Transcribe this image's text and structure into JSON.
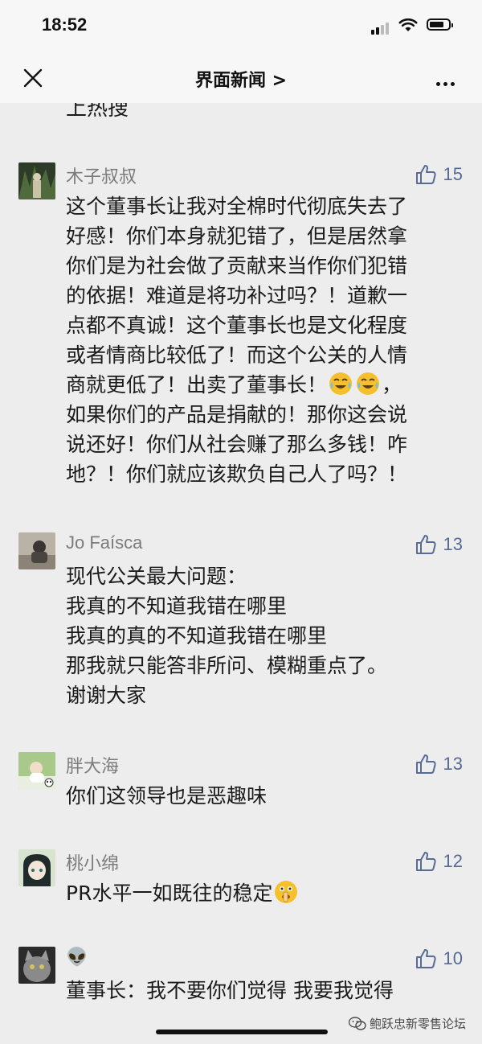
{
  "status_bar": {
    "time": "18:52"
  },
  "nav": {
    "title": "界面新闻 >"
  },
  "truncated_text": "上热搜",
  "comments": [
    {
      "user": "木子叔叔",
      "likes": "15",
      "text_a": "这个董事长让我对全棉时代彻底失去了\n好感！你们本身就犯错了，但是居然拿\n你们是为社会做了贡献来当作你们犯错\n的依据！难道是将功补过吗？！道歉一\n点都不真诚！这个董事长也是文化程度\n或者情商比较低了！而这个公关的人情\n商就更低了！出卖了董事长！",
      "text_b": "，\n如果你们的产品是捐献的！那你这会说\n说还好！你们从社会赚了那么多钱！咋\n地？！你们就应该欺负自己人了吗？！",
      "emojis": [
        "crying-laughing-emoji",
        "crying-laughing-emoji"
      ]
    },
    {
      "user": "Jo Faísca",
      "likes": "13",
      "text": "现代公关最大问题：\n我真的不知道我错在哪里\n我真的真的不知道我错在哪里\n那我就只能答非所问、模糊重点了。\n谢谢大家"
    },
    {
      "user": "胖大海",
      "likes": "13",
      "text": "你们这领导也是恶趣味"
    },
    {
      "user": "桃小绵",
      "likes": "12",
      "text": "PR水平一如既往的稳定",
      "emoji": "shushing-face-emoji"
    },
    {
      "user": "👽",
      "likes": "10",
      "text": "董事长：我不要你们觉得 我要我觉得"
    }
  ],
  "watermark": {
    "text": "鲍跃忠新零售论坛",
    "icon": "wechat-icon"
  },
  "colors": {
    "background": "#ededed",
    "like_blue": "#576b95",
    "username_gray": "#7b7b7b"
  },
  "battery_level": 0.75
}
